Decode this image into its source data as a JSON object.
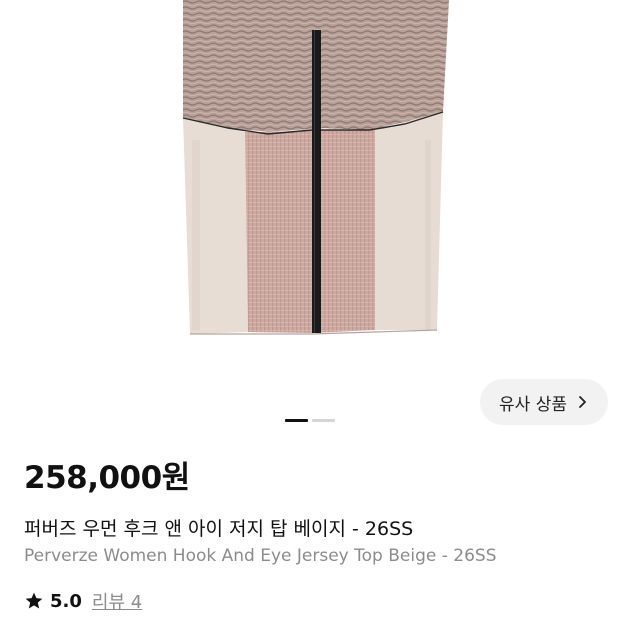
{
  "gallery": {
    "image_alt": "Perverze Women Hook And Eye Jersey Top Beige",
    "similar_button_label": "유사 상품",
    "chevron_icon": "chevron-right-icon",
    "indicator": {
      "total": 2,
      "active": 1
    }
  },
  "product": {
    "price": "258,000원",
    "title_ko": "퍼버즈 우먼 후크 앤 아이 저지 탑 베이지 - 26SS",
    "title_en": "Perverze Women Hook And Eye Jersey Top Beige - 26SS",
    "rating": "5.0",
    "reviews_label": "리뷰 4",
    "star_icon": "star-icon"
  },
  "colors": {
    "knit_top": "#b8a099",
    "knit_center": "#caa79f",
    "side_panel": "#e8ddd5",
    "hook_strip": "#1a1a1a",
    "price_text": "#111111",
    "subtitle_gray": "#8c8c8c",
    "button_bg": "#f2f2f2"
  }
}
